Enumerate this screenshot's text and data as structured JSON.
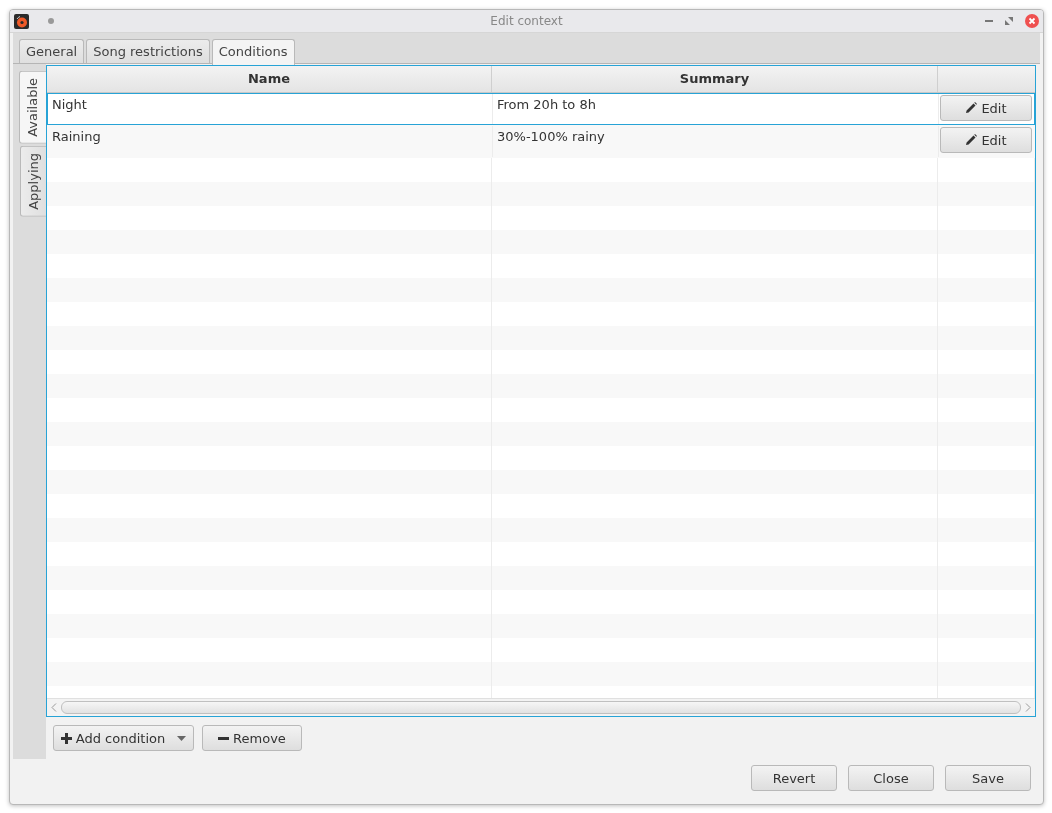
{
  "window": {
    "title": "Edit context"
  },
  "tabs": [
    {
      "label": "General",
      "selected": false
    },
    {
      "label": "Song restrictions",
      "selected": false
    },
    {
      "label": "Conditions",
      "selected": true
    }
  ],
  "side_tabs": [
    {
      "label": "Available",
      "selected": true
    },
    {
      "label": "Applying",
      "selected": false
    }
  ],
  "table": {
    "columns": [
      "Name",
      "Summary"
    ],
    "rows": [
      {
        "name": "Night",
        "summary": "From 20h to 8h",
        "action": "Edit",
        "selected": true
      },
      {
        "name": "Raining",
        "summary": "30%-100% rainy",
        "action": "Edit",
        "selected": false
      }
    ]
  },
  "actions": {
    "add": "Add condition",
    "remove": "Remove"
  },
  "buttons": [
    "Revert",
    "Close",
    "Save"
  ]
}
